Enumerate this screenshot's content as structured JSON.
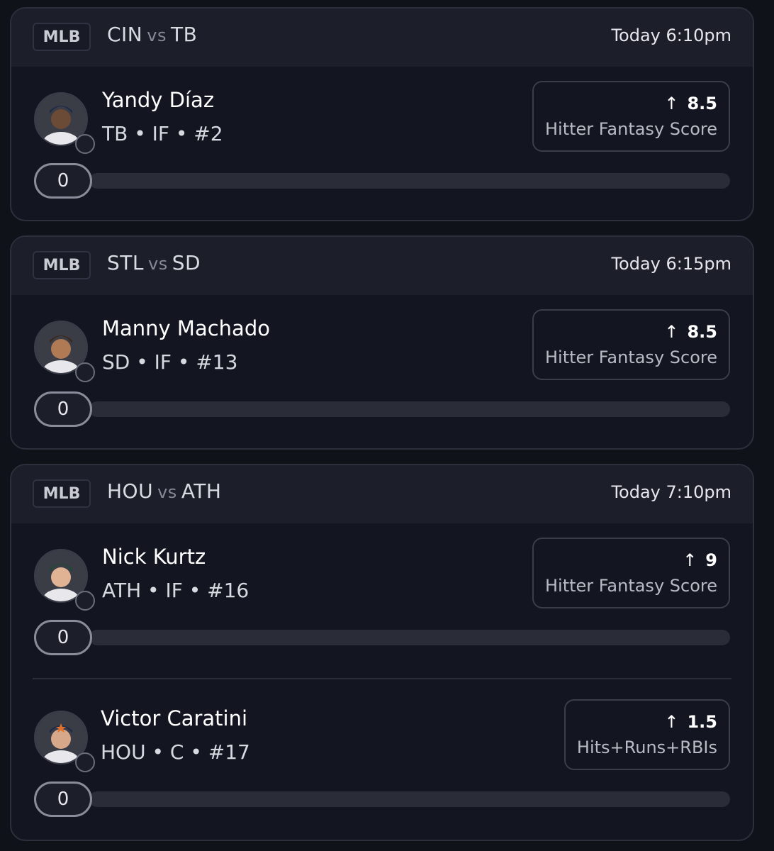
{
  "games": [
    {
      "league": "MLB",
      "away": "CIN",
      "vs": "vs",
      "home": "TB",
      "time": "Today 6:10pm",
      "picks": [
        {
          "name": "Yandy Díaz",
          "meta": "TB • IF • #2",
          "direction_icon": "arrow-up-icon",
          "line": "8.5",
          "stat": "Hitter Fantasy Score",
          "progress_value": "0",
          "progress_fraction": 0,
          "cap_color": "#1d2b4a"
        }
      ]
    },
    {
      "league": "MLB",
      "away": "STL",
      "vs": "vs",
      "home": "SD",
      "time": "Today 6:15pm",
      "picks": [
        {
          "name": "Manny Machado",
          "meta": "SD • IF • #13",
          "direction_icon": "arrow-up-icon",
          "line": "8.5",
          "stat": "Hitter Fantasy Score",
          "progress_value": "0",
          "progress_fraction": 0,
          "cap_color": "#3b2a1a"
        }
      ]
    },
    {
      "league": "MLB",
      "away": "HOU",
      "vs": "vs",
      "home": "ATH",
      "time": "Today 7:10pm",
      "picks": [
        {
          "name": "Nick Kurtz",
          "meta": "ATH • IF • #16",
          "direction_icon": "arrow-up-icon",
          "line": "9",
          "stat": "Hitter Fantasy Score",
          "progress_value": "0",
          "progress_fraction": 0,
          "cap_color": "#1f4a35"
        },
        {
          "name": "Victor Caratini",
          "meta": "HOU • C • #17",
          "direction_icon": "arrow-up-icon",
          "line": "1.5",
          "stat": "Hits+Runs+RBIs",
          "progress_value": "0",
          "progress_fraction": 0,
          "cap_color": "#1d2a4a"
        }
      ]
    }
  ]
}
